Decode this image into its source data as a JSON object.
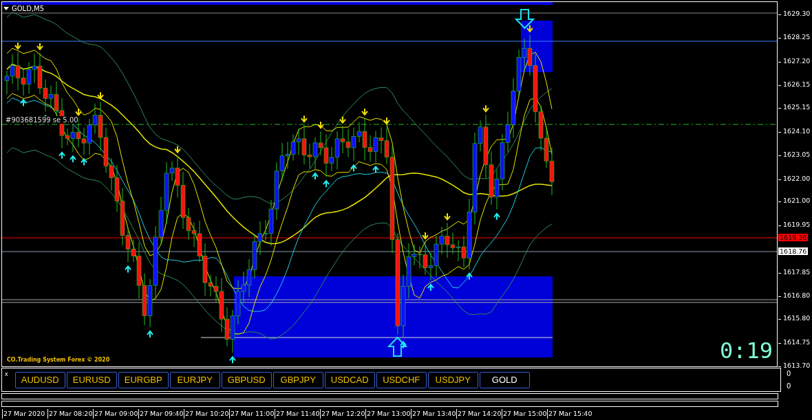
{
  "window": {
    "title": "GOLD,M5"
  },
  "chart": {
    "order_label": "#903681599 se 5.00",
    "branding": "CO.Trading System Forex © 2020",
    "timer": "0:19"
  },
  "price_axis": {
    "ticks": [
      "1629.30",
      "1628.25",
      "1627.20",
      "1626.15",
      "1625.15",
      "1624.10",
      "1623.05",
      "1622.00",
      "1621.00",
      "1619.95",
      "1617.85",
      "1616.80",
      "1615.80",
      "1614.75",
      "1613.70"
    ],
    "bid_label": "1619.36",
    "line_label": "1618.76"
  },
  "symbol_panel": {
    "close": "x",
    "buttons": [
      {
        "label": "AUDUSD",
        "selected": false
      },
      {
        "label": "EURUSD",
        "selected": false
      },
      {
        "label": "EURGBP",
        "selected": false
      },
      {
        "label": "EURJPY",
        "selected": false
      },
      {
        "label": "GBPUSD",
        "selected": false
      },
      {
        "label": "GBPJPY",
        "selected": false
      },
      {
        "label": "USDCAD",
        "selected": false
      },
      {
        "label": "USDCHF",
        "selected": false
      },
      {
        "label": "USDJPY",
        "selected": false
      },
      {
        "label": "GOLD",
        "selected": true
      }
    ],
    "axis_labels": [
      "0",
      "0"
    ]
  },
  "time_axis": [
    "27 Mar 2020",
    "27 Mar 08:20",
    "27 Mar 09:00",
    "27 Mar 09:40",
    "27 Mar 10:20",
    "27 Mar 11:00",
    "27 Mar 11:40",
    "27 Mar 12:20",
    "27 Mar 13:00",
    "27 Mar 13:40",
    "27 Mar 14:20",
    "27 Mar 15:00",
    "27 Mar 15:40"
  ]
}
